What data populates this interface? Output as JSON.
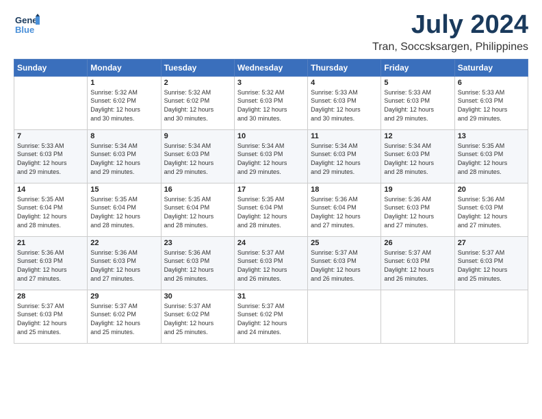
{
  "header": {
    "logo_general": "General",
    "logo_blue": "Blue",
    "month": "July 2024",
    "location": "Tran, Soccsksargen, Philippines"
  },
  "days_of_week": [
    "Sunday",
    "Monday",
    "Tuesday",
    "Wednesday",
    "Thursday",
    "Friday",
    "Saturday"
  ],
  "weeks": [
    [
      {
        "day": "",
        "content": ""
      },
      {
        "day": "1",
        "content": "Sunrise: 5:32 AM\nSunset: 6:02 PM\nDaylight: 12 hours\nand 30 minutes."
      },
      {
        "day": "2",
        "content": "Sunrise: 5:32 AM\nSunset: 6:02 PM\nDaylight: 12 hours\nand 30 minutes."
      },
      {
        "day": "3",
        "content": "Sunrise: 5:32 AM\nSunset: 6:03 PM\nDaylight: 12 hours\nand 30 minutes."
      },
      {
        "day": "4",
        "content": "Sunrise: 5:33 AM\nSunset: 6:03 PM\nDaylight: 12 hours\nand 30 minutes."
      },
      {
        "day": "5",
        "content": "Sunrise: 5:33 AM\nSunset: 6:03 PM\nDaylight: 12 hours\nand 29 minutes."
      },
      {
        "day": "6",
        "content": "Sunrise: 5:33 AM\nSunset: 6:03 PM\nDaylight: 12 hours\nand 29 minutes."
      }
    ],
    [
      {
        "day": "7",
        "content": "Sunrise: 5:33 AM\nSunset: 6:03 PM\nDaylight: 12 hours\nand 29 minutes."
      },
      {
        "day": "8",
        "content": "Sunrise: 5:34 AM\nSunset: 6:03 PM\nDaylight: 12 hours\nand 29 minutes."
      },
      {
        "day": "9",
        "content": "Sunrise: 5:34 AM\nSunset: 6:03 PM\nDaylight: 12 hours\nand 29 minutes."
      },
      {
        "day": "10",
        "content": "Sunrise: 5:34 AM\nSunset: 6:03 PM\nDaylight: 12 hours\nand 29 minutes."
      },
      {
        "day": "11",
        "content": "Sunrise: 5:34 AM\nSunset: 6:03 PM\nDaylight: 12 hours\nand 29 minutes."
      },
      {
        "day": "12",
        "content": "Sunrise: 5:34 AM\nSunset: 6:03 PM\nDaylight: 12 hours\nand 28 minutes."
      },
      {
        "day": "13",
        "content": "Sunrise: 5:35 AM\nSunset: 6:03 PM\nDaylight: 12 hours\nand 28 minutes."
      }
    ],
    [
      {
        "day": "14",
        "content": "Sunrise: 5:35 AM\nSunset: 6:04 PM\nDaylight: 12 hours\nand 28 minutes."
      },
      {
        "day": "15",
        "content": "Sunrise: 5:35 AM\nSunset: 6:04 PM\nDaylight: 12 hours\nand 28 minutes."
      },
      {
        "day": "16",
        "content": "Sunrise: 5:35 AM\nSunset: 6:04 PM\nDaylight: 12 hours\nand 28 minutes."
      },
      {
        "day": "17",
        "content": "Sunrise: 5:35 AM\nSunset: 6:04 PM\nDaylight: 12 hours\nand 28 minutes."
      },
      {
        "day": "18",
        "content": "Sunrise: 5:36 AM\nSunset: 6:04 PM\nDaylight: 12 hours\nand 27 minutes."
      },
      {
        "day": "19",
        "content": "Sunrise: 5:36 AM\nSunset: 6:03 PM\nDaylight: 12 hours\nand 27 minutes."
      },
      {
        "day": "20",
        "content": "Sunrise: 5:36 AM\nSunset: 6:03 PM\nDaylight: 12 hours\nand 27 minutes."
      }
    ],
    [
      {
        "day": "21",
        "content": "Sunrise: 5:36 AM\nSunset: 6:03 PM\nDaylight: 12 hours\nand 27 minutes."
      },
      {
        "day": "22",
        "content": "Sunrise: 5:36 AM\nSunset: 6:03 PM\nDaylight: 12 hours\nand 27 minutes."
      },
      {
        "day": "23",
        "content": "Sunrise: 5:36 AM\nSunset: 6:03 PM\nDaylight: 12 hours\nand 26 minutes."
      },
      {
        "day": "24",
        "content": "Sunrise: 5:37 AM\nSunset: 6:03 PM\nDaylight: 12 hours\nand 26 minutes."
      },
      {
        "day": "25",
        "content": "Sunrise: 5:37 AM\nSunset: 6:03 PM\nDaylight: 12 hours\nand 26 minutes."
      },
      {
        "day": "26",
        "content": "Sunrise: 5:37 AM\nSunset: 6:03 PM\nDaylight: 12 hours\nand 26 minutes."
      },
      {
        "day": "27",
        "content": "Sunrise: 5:37 AM\nSunset: 6:03 PM\nDaylight: 12 hours\nand 25 minutes."
      }
    ],
    [
      {
        "day": "28",
        "content": "Sunrise: 5:37 AM\nSunset: 6:03 PM\nDaylight: 12 hours\nand 25 minutes."
      },
      {
        "day": "29",
        "content": "Sunrise: 5:37 AM\nSunset: 6:02 PM\nDaylight: 12 hours\nand 25 minutes."
      },
      {
        "day": "30",
        "content": "Sunrise: 5:37 AM\nSunset: 6:02 PM\nDaylight: 12 hours\nand 25 minutes."
      },
      {
        "day": "31",
        "content": "Sunrise: 5:37 AM\nSunset: 6:02 PM\nDaylight: 12 hours\nand 24 minutes."
      },
      {
        "day": "",
        "content": ""
      },
      {
        "day": "",
        "content": ""
      },
      {
        "day": "",
        "content": ""
      }
    ]
  ]
}
